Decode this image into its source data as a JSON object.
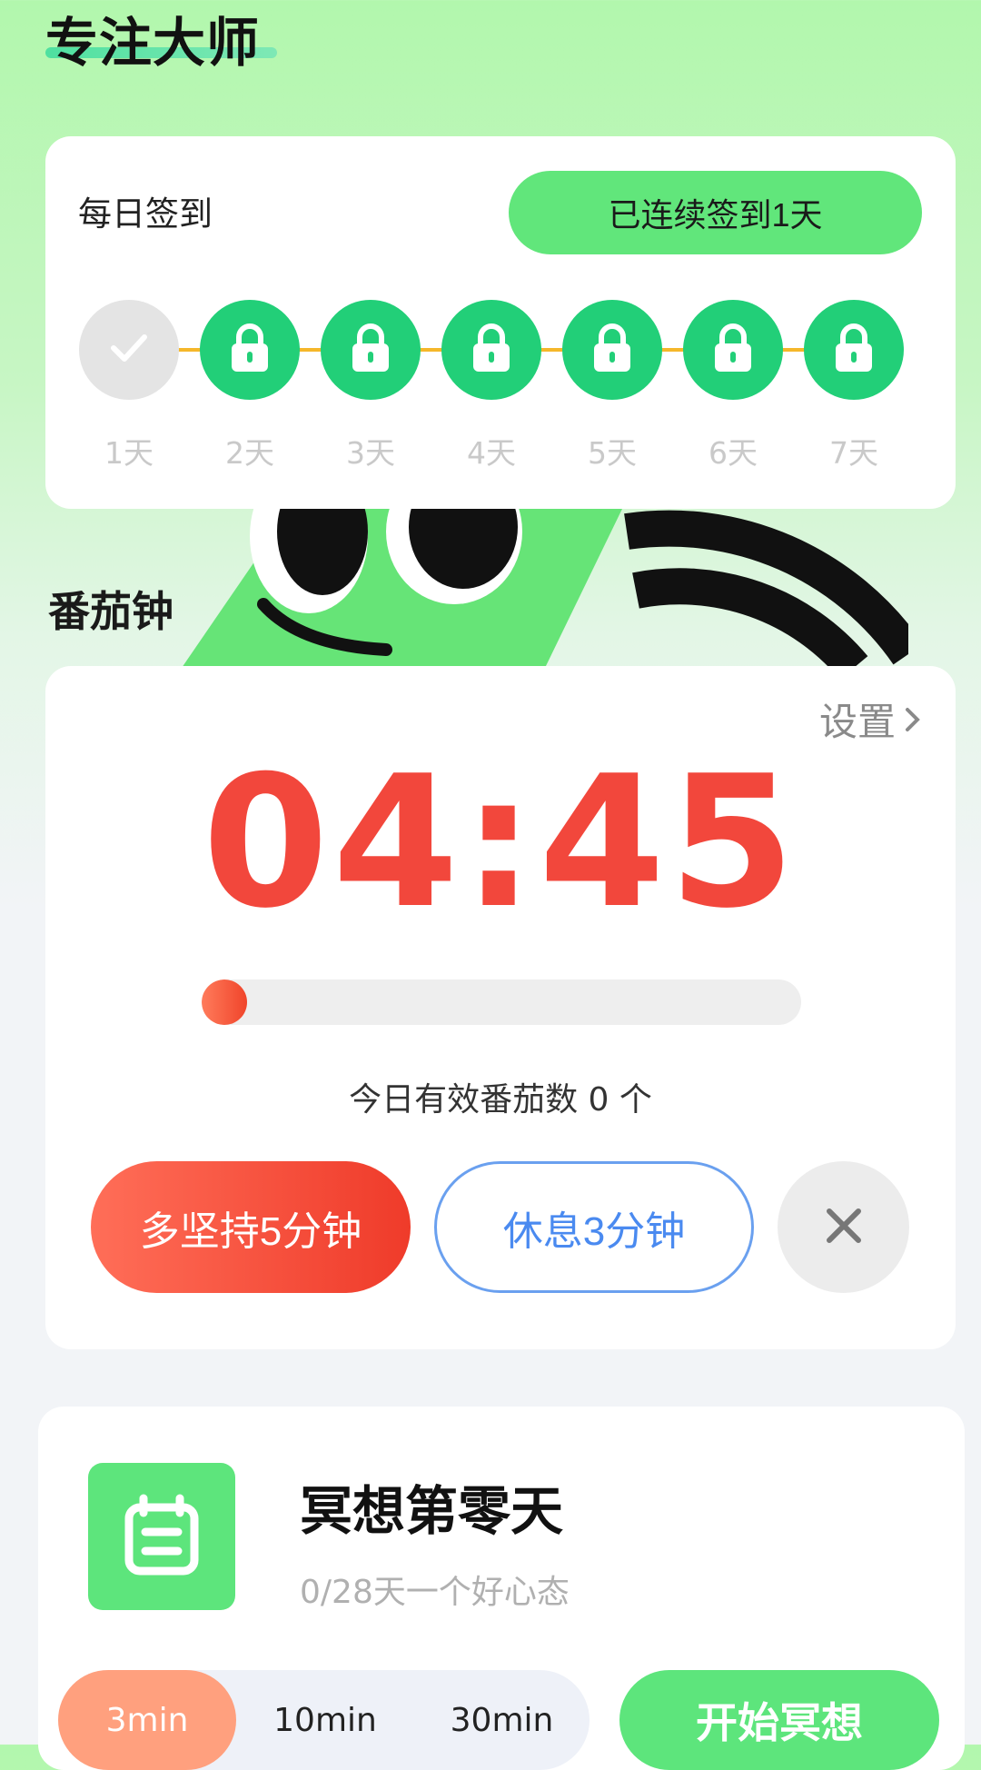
{
  "app": {
    "title": "专注大师"
  },
  "checkin": {
    "title": "每日签到",
    "streak_label": "已连续签到1天",
    "days": [
      {
        "label": "1天",
        "state": "done"
      },
      {
        "label": "2天",
        "state": "locked"
      },
      {
        "label": "3天",
        "state": "locked"
      },
      {
        "label": "4天",
        "state": "locked"
      },
      {
        "label": "5天",
        "state": "locked"
      },
      {
        "label": "6天",
        "state": "locked"
      },
      {
        "label": "7天",
        "state": "locked"
      }
    ]
  },
  "tomato": {
    "section_title": "番茄钟",
    "settings_label": "设置",
    "timer": "04:45",
    "progress": 0.05,
    "count_text": "今日有效番茄数 0 个",
    "extend_label": "多坚持5分钟",
    "rest_label": "休息3分钟"
  },
  "meditation": {
    "title": "冥想第零天",
    "subtitle": "0/28天一个好心态",
    "durations": [
      "3min",
      "10min",
      "30min"
    ],
    "selected_duration": "3min",
    "start_label": "开始冥想"
  },
  "colors": {
    "brand_green": "#61e67b",
    "lock_green": "#22cf78",
    "timer_red": "#f2473c",
    "rest_blue": "#4a8af0",
    "duration_active": "#ffa07e"
  }
}
